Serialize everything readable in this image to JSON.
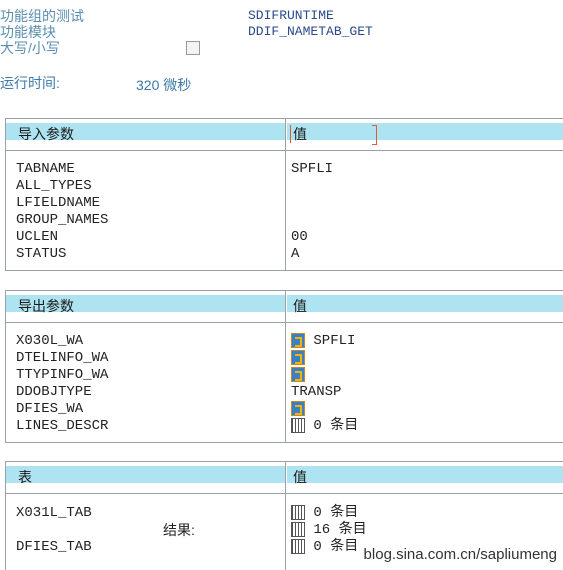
{
  "header": {
    "group_label": "功能组的测试",
    "group_value": "SDIFRUNTIME",
    "module_label": "功能模块",
    "module_value": "DDIF_NAMETAB_GET",
    "case_label": "大写/小写",
    "runtime_label": "运行时间:",
    "runtime_value": "320 微秒"
  },
  "import_section": {
    "title": "导入参数",
    "value_header": "值",
    "rows": [
      {
        "name": "TABNAME",
        "value": "SPFLI"
      },
      {
        "name": "ALL_TYPES",
        "value": ""
      },
      {
        "name": "LFIELDNAME",
        "value": ""
      },
      {
        "name": "GROUP_NAMES",
        "value": ""
      },
      {
        "name": "UCLEN",
        "value": "00"
      },
      {
        "name": "STATUS",
        "value": "A"
      }
    ]
  },
  "export_section": {
    "title": "导出参数",
    "value_header": "值",
    "rows": [
      {
        "name": "X030L_WA",
        "value": "SPFLI",
        "icon": "structure-icon"
      },
      {
        "name": "DTELINFO_WA",
        "value": "",
        "icon": "structure-icon"
      },
      {
        "name": "TTYPINFO_WA",
        "value": "",
        "icon": "structure-icon"
      },
      {
        "name": "DDOBJTYPE",
        "value": "TRANSP",
        "icon": ""
      },
      {
        "name": "DFIES_WA",
        "value": "",
        "icon": "structure-icon"
      },
      {
        "name": "LINES_DESCR",
        "value": "0 条目",
        "icon": "table-icon"
      }
    ]
  },
  "tables_section": {
    "title": "表",
    "value_header": "值",
    "rows": [
      {
        "name": "X031L_TAB",
        "value": "0 条目",
        "icon": "table-icon"
      },
      {
        "name": "",
        "value": "16 条目",
        "icon": "table-icon",
        "label": "结果:"
      },
      {
        "name": "DFIES_TAB",
        "value": "0 条目",
        "icon": "table-icon"
      }
    ]
  },
  "watermark": "blog.sina.com.cn/sapliumeng"
}
